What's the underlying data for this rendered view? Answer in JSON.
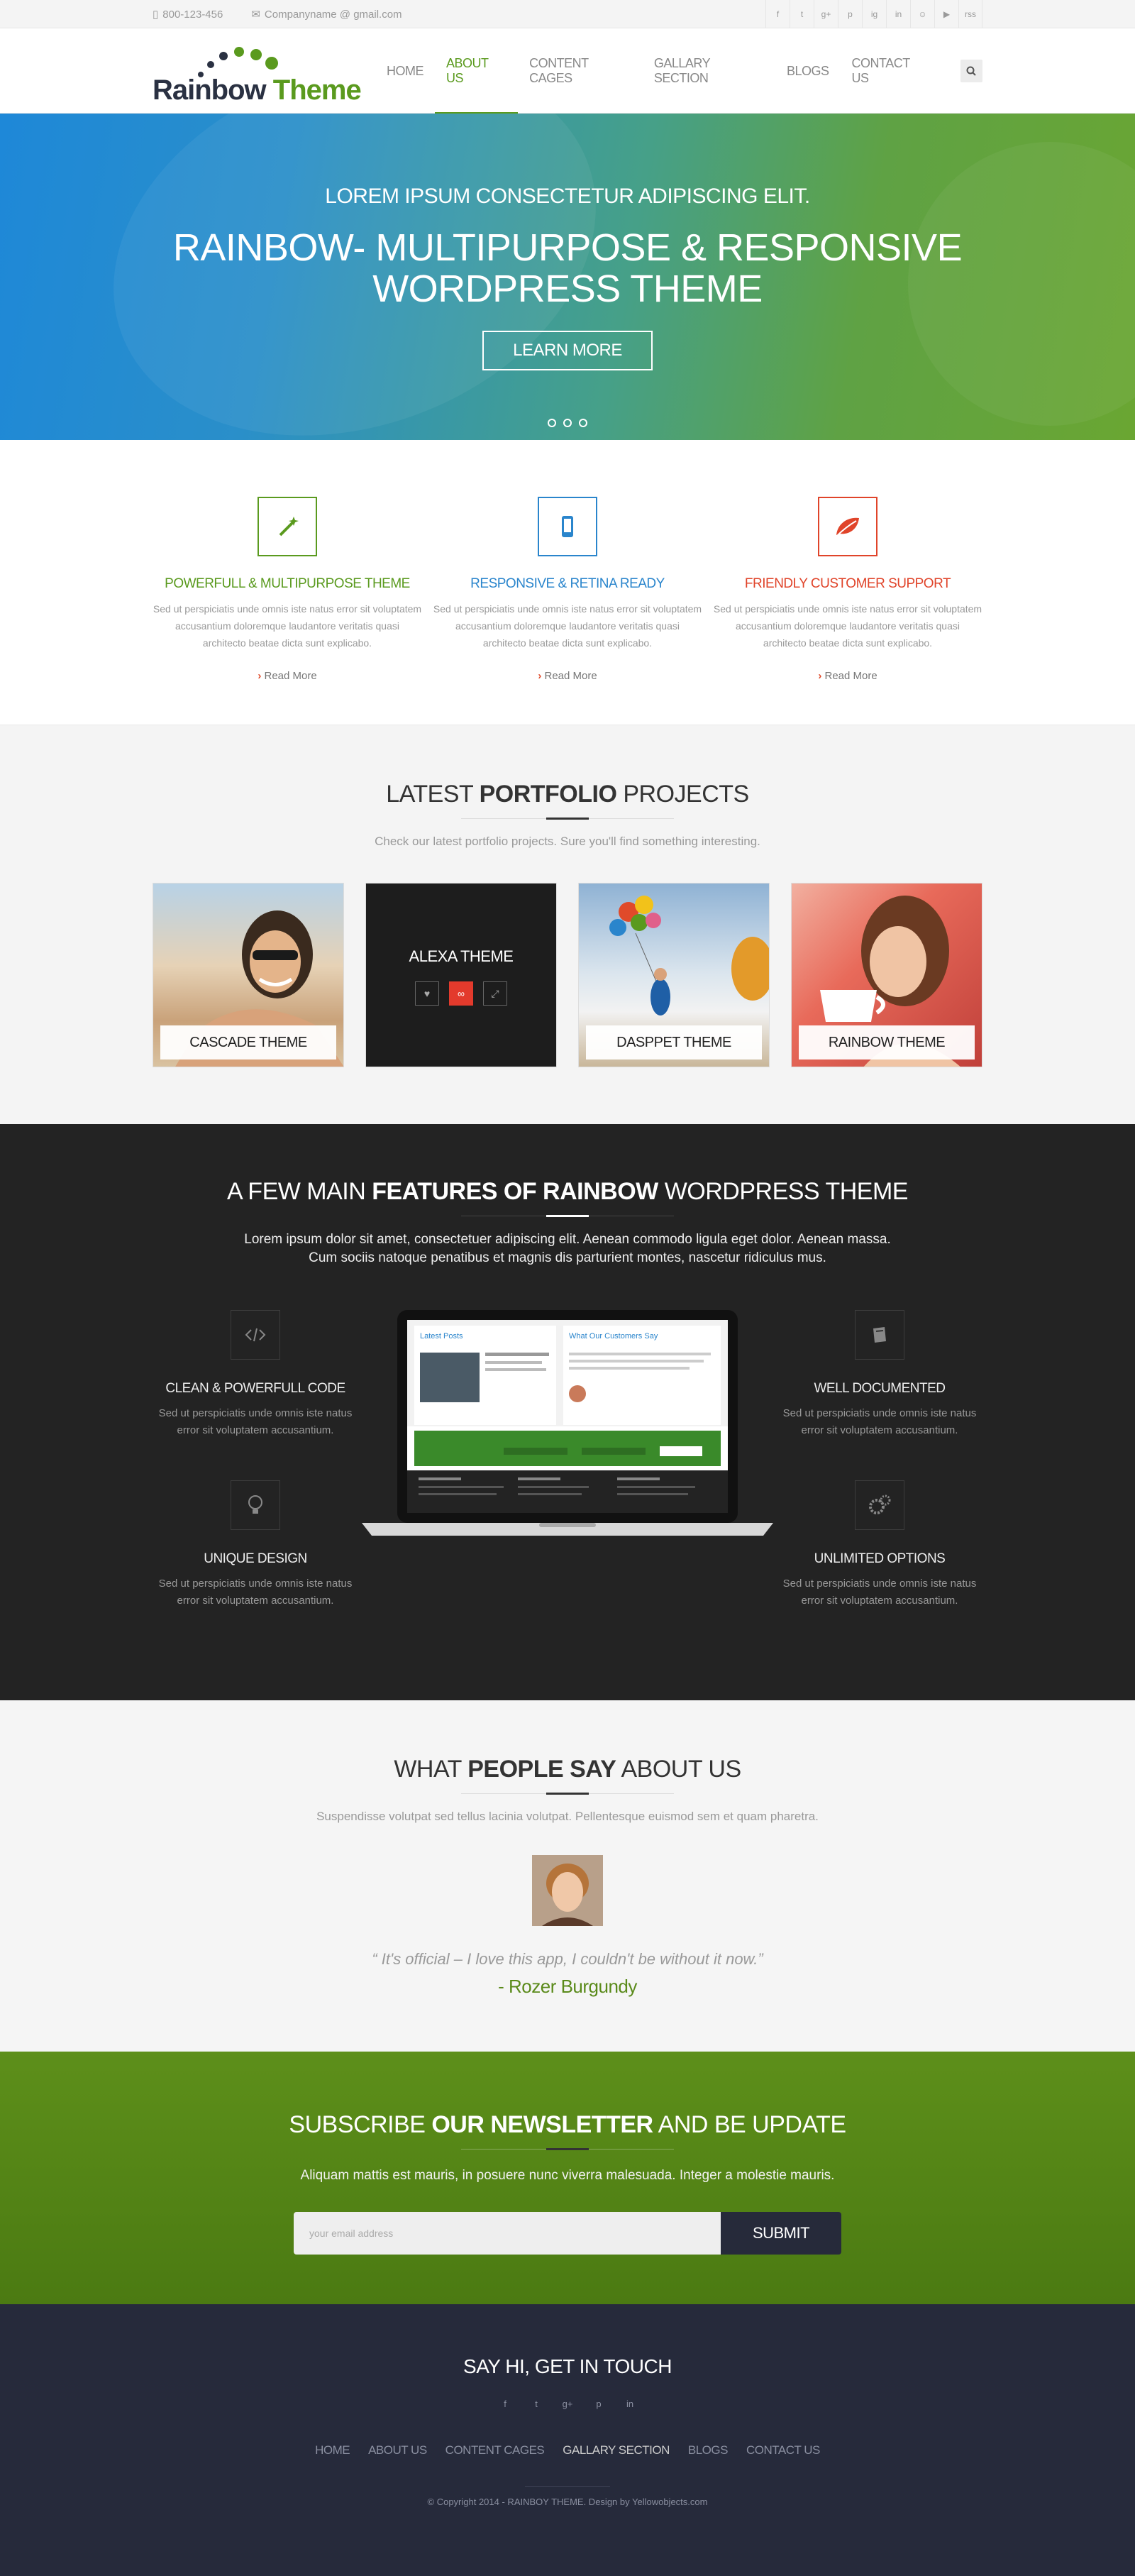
{
  "topbar": {
    "phone": "800-123-456",
    "email": "Companyname @ gmail.com",
    "social": [
      "f",
      "t",
      "g+",
      "p",
      "ig",
      "in",
      "☺",
      "▶",
      "rss"
    ]
  },
  "logo": {
    "word1": "Rainbow",
    "word2": " Theme"
  },
  "nav": [
    "HOME",
    "ABOUT US",
    "CONTENT CAGES",
    "GALLARY SECTION",
    "BLOGS",
    "CONTACT US"
  ],
  "hero": {
    "kicker": "LOREM IPSUM CONSECTETUR ADIPISCING ELIT.",
    "title1": "RAINBOW- MULTIPURPOSE & RESPONSIVE",
    "title2": "WORDPRESS THEME",
    "button": "LEARN MORE"
  },
  "services": [
    {
      "title": "POWERFULL & MULTIPURPOSE THEME",
      "text": "Sed ut perspiciatis unde omnis iste natus error sit voluptatem accusantium doloremque laudantore veritatis quasi architecto beatae dicta sunt explicabo.",
      "more": "Read More",
      "color": "#5a9a1e"
    },
    {
      "title": "RESPONSIVE & RETINA READY",
      "text": "Sed ut perspiciatis unde omnis iste natus error sit voluptatem accusantium doloremque laudantore veritatis quasi architecto beatae dicta sunt explicabo.",
      "more": "Read More",
      "color": "#2a85cc"
    },
    {
      "title": "FRIENDLY CUSTOMER SUPPORT",
      "text": "Sed ut perspiciatis unde omnis iste natus error sit voluptatem accusantium doloremque laudantore veritatis quasi architecto beatae dicta sunt explicabo.",
      "more": "Read More",
      "color": "#e0442a"
    }
  ],
  "portfolio": {
    "t1": "LATEST ",
    "t2": "PORTFOLIO",
    "t3": " PROJECTS",
    "sub": "Check our latest portfolio projects. Sure you'll find something interesting.",
    "items": [
      "CASCADE THEME",
      "ALEXA THEME",
      "DASPPET THEME",
      "RAINBOW THEME"
    ]
  },
  "features": {
    "t1": "A FEW MAIN ",
    "t2": "FEATURES OF RAINBOW",
    "t3": " WORDPRESS THEME",
    "desc1": "Lorem ipsum dolor sit amet, consectetuer adipiscing elit. Aenean commodo ligula eget dolor. Aenean massa.",
    "desc2": "Cum sociis natoque penatibus et magnis dis parturient montes, nascetur ridiculus mus.",
    "items": [
      {
        "title": "CLEAN & POWERFULL CODE",
        "text": "Sed ut perspiciatis unde omnis iste natus error sit voluptatem accusantium."
      },
      {
        "title": "UNIQUE DESIGN",
        "text": "Sed ut perspiciatis unde omnis iste natus error sit voluptatem accusantium."
      },
      {
        "title": "WELL DOCUMENTED",
        "text": "Sed ut perspiciatis unde omnis iste natus error sit voluptatem accusantium."
      },
      {
        "title": "UNLIMITED OPTIONS",
        "text": "Sed ut perspiciatis unde omnis iste natus error sit voluptatem accusantium."
      }
    ],
    "screen": {
      "latest": "Latest Posts",
      "customers": "What Our Customers Say"
    }
  },
  "testimonial": {
    "t1": "WHAT ",
    "t2": "PEOPLE SAY",
    "t3": " ABOUT US",
    "sub": "Suspendisse volutpat sed tellus lacinia volutpat. Pellentesque euismod sem et quam pharetra.",
    "quote": "“ It's official – I love this app, I couldn't be without it now.”",
    "author": "- Rozer Burgundy"
  },
  "newsletter": {
    "t1": "SUBSCRIBE ",
    "t2": "OUR NEWSLETTER",
    "t3": " AND BE UPDATE",
    "desc": "Aliquam mattis est mauris, in posuere nunc viverra malesuada. Integer a molestie mauris.",
    "placeholder": "your email address",
    "button": "SUBMIT"
  },
  "footer": {
    "title": "SAY HI, GET IN TOUCH",
    "social": [
      "f",
      "t",
      "g+",
      "p",
      "in"
    ],
    "nav": [
      "HOME",
      "ABOUT US",
      "CONTENT CAGES",
      "GALLARY SECTION",
      "BLOGS",
      "CONTACT US"
    ],
    "copy": "© Copyright 2014 - RAINBOY THEME. Design by Yellowobjects.com"
  },
  "colors": {
    "green": "#5a9a1e",
    "blue": "#2a85cc",
    "red": "#e0442a",
    "navy": "#262a3b",
    "dark": "#232323"
  }
}
